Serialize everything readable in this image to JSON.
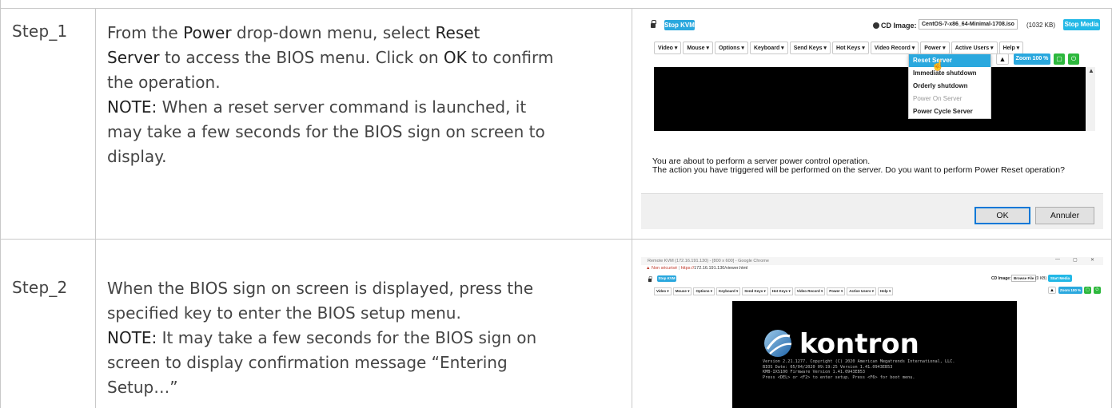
{
  "steps": [
    {
      "label": "Step_1",
      "lines": [
        [
          {
            "t": "From the "
          },
          {
            "t": "Power",
            "kw": true
          },
          {
            "t": " drop-down menu, select "
          },
          {
            "t": "Reset",
            "kw": true
          }
        ],
        [
          {
            "t": "Server",
            "kw": true
          },
          {
            "t": " to access the BIOS menu. Click on "
          },
          {
            "t": "OK",
            "kw": true
          },
          {
            "t": " to confirm"
          }
        ],
        [
          {
            "t": "the operation."
          }
        ],
        [
          {
            "t": "NOTE:",
            "kw": true
          },
          {
            "t": " When a reset server command is launched, it"
          }
        ],
        [
          {
            "t": "may take a few seconds for the BIOS sign on screen to"
          }
        ],
        [
          {
            "t": "display."
          }
        ]
      ]
    },
    {
      "label": "Step_2",
      "lines": [
        [
          {
            "t": "When the BIOS sign on screen is displayed, press the"
          }
        ],
        [
          {
            "t": "specified key to enter the BIOS setup menu."
          }
        ],
        [
          {
            "t": "NOTE:",
            "kw": true
          },
          {
            "t": " It may take a few seconds for the BIOS sign on"
          }
        ],
        [
          {
            "t": "screen to display confirmation message “Entering"
          }
        ],
        [
          {
            "t": "Setup…”"
          }
        ]
      ]
    }
  ],
  "shot1": {
    "stop_kvm": "Stop KVM",
    "cd_label": "CD Image:",
    "cd_file": "CentOS-7-x86_64-Minimal-1708.iso",
    "cd_size": "(1032 KB)",
    "stop_media": "Stop Media",
    "menus": [
      "Video ▾",
      "Mouse ▾",
      "Options ▾",
      "Keyboard ▾",
      "Send Keys ▾",
      "Hot Keys ▾",
      "Video Record ▾",
      "Power ▾",
      "Active Users ▾",
      "Help ▾"
    ],
    "zoom": "Zoom 100 %",
    "power_menu": [
      {
        "label": "Reset Server",
        "state": "active"
      },
      {
        "label": "Immediate shutdown",
        "state": "normal"
      },
      {
        "label": "Orderly shutdown",
        "state": "normal"
      },
      {
        "label": "Power On Server",
        "state": "disabled"
      },
      {
        "label": "Power Cycle Server",
        "state": "normal"
      }
    ],
    "dialog_line1": "You are about to perform a server power control operation.",
    "dialog_line2": "The action you have triggered will be performed on the server. Do you want to perform Power Reset operation?",
    "ok": "OK",
    "cancel": "Annuler"
  },
  "shot2": {
    "window_title": "Remote KVM (172.16.191.130) - [800 x 600] - Google Chrome",
    "not_secure": "Non sécurisé",
    "url_scheme": "https://",
    "url_rest": "172.16.191.130/viewer.html",
    "stop_kvm": "Stop KVM",
    "cd_label": "CD Image:",
    "browse": "Browse File",
    "cd_size": "(0 KB)",
    "start_media": "Start Media",
    "menus": [
      "Video ▾",
      "Mouse ▾",
      "Options ▾",
      "Keyboard ▾",
      "Send Keys ▾",
      "Hot Keys ▾",
      "Video Record ▾",
      "Power ▾",
      "Active Users ▾",
      "Help ▾"
    ],
    "zoom": "Zoom 100 %",
    "brand": "kontron",
    "bios_lines": [
      "Version 2.21.1277. Copyright (C) 2020 American Megatrends International, LLC.",
      "BIOS Date: 05/04/2020 09:19:25 Version 1.41.0943EB53",
      "KMB-IXS100 Firmware Version 1.41.0943EB53",
      "Press <DEL> or <F2> to enter setup. Press <F6> for boot menu."
    ]
  }
}
